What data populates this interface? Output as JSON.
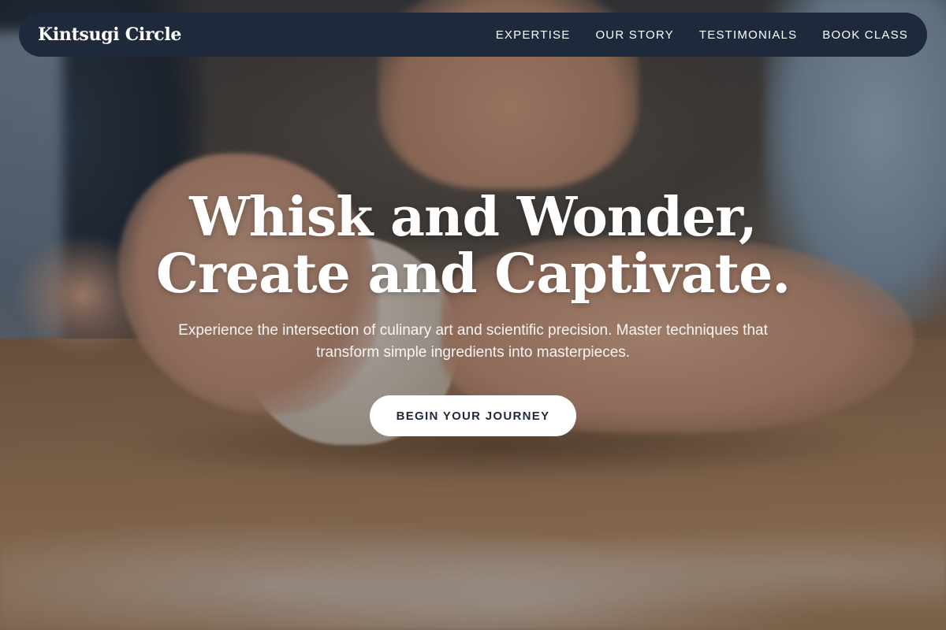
{
  "nav": {
    "brand": "Kintsugi Circle",
    "links": [
      "EXPERTISE",
      "OUR STORY",
      "TESTIMONIALS",
      "BOOK CLASS"
    ]
  },
  "hero": {
    "title_line1": "Whisk and Wonder,",
    "title_line2": "Create and Captivate.",
    "subtitle_line1": "Experience the intersection of culinary art and scientific precision. Master techniques that",
    "subtitle_line2": "transform simple ingredients into masterpieces.",
    "cta_label": "BEGIN YOUR JOURNEY",
    "background_image": "hands kneading dough on a floured wooden counter"
  },
  "colors": {
    "nav_background": "#1e293b",
    "text_light": "#ffffff",
    "button_background": "#ffffff",
    "button_text": "#1e293b"
  }
}
